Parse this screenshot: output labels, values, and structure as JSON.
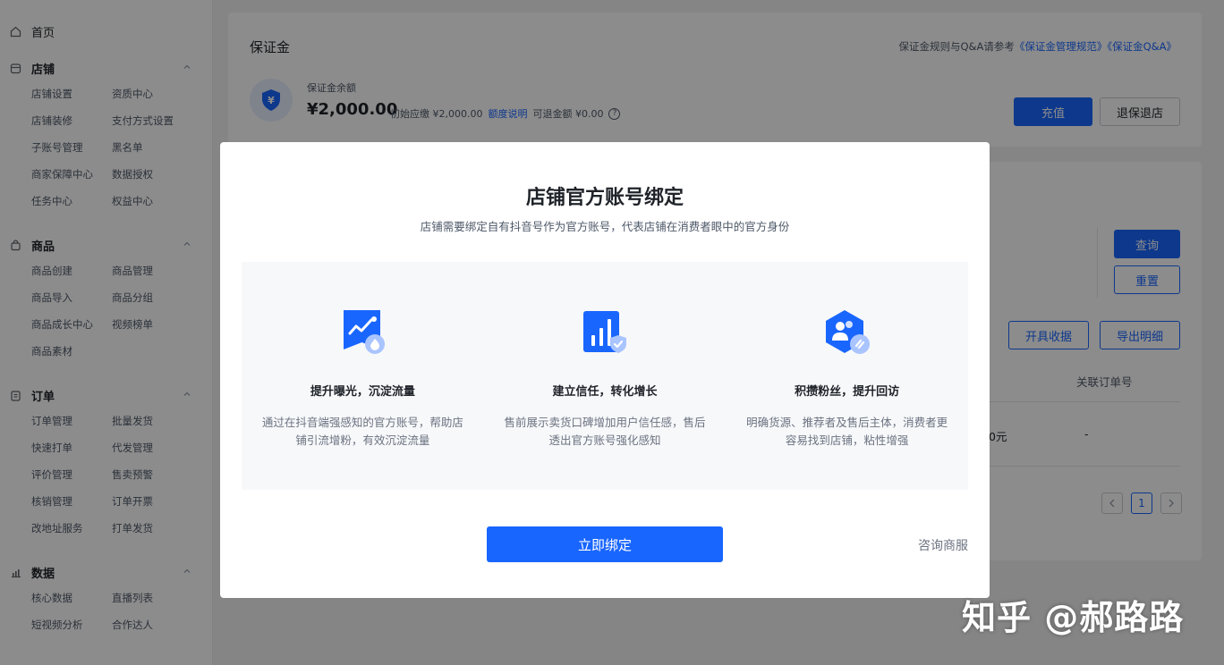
{
  "sidebar": {
    "home": "首页",
    "sections": [
      {
        "title": "店铺",
        "items": [
          "店铺设置",
          "资质中心",
          "店铺装修",
          "支付方式设置",
          "子账号管理",
          "黑名单",
          "商家保障中心",
          "数据授权",
          "任务中心",
          "权益中心"
        ]
      },
      {
        "title": "商品",
        "items": [
          "商品创建",
          "商品管理",
          "商品导入",
          "商品分组",
          "商品成长中心",
          "视频榜单",
          "商品素材"
        ]
      },
      {
        "title": "订单",
        "items": [
          "订单管理",
          "批量发货",
          "快速打单",
          "代发管理",
          "评价管理",
          "售卖预警",
          "核销管理",
          "订单开票",
          "改地址服务",
          "打单发货"
        ]
      },
      {
        "title": "数据",
        "items": [
          "核心数据",
          "直播列表",
          "短视频分析",
          "合作达人"
        ]
      }
    ]
  },
  "deposit": {
    "title": "保证金",
    "rule_prefix": "保证金规则与Q&A请参考",
    "rule_link1": "《保证金管理规范》",
    "rule_link2": "《保证金Q&A》",
    "balance_label": "保证金余额",
    "balance_amount": "¥2,000.00",
    "initial_due": "初始应缴 ¥2,000.00",
    "quota_link": "额度说明",
    "refundable": "可退金额 ¥0.00",
    "recharge_button": "充值",
    "refund_button": "退保退店"
  },
  "records": {
    "query_button": "查询",
    "reset_button": "重置",
    "invoice_button": "开具收据",
    "export_button": "导出明细",
    "col_related_order": "关联订单号",
    "cell_amount": "0元",
    "cell_order": "-",
    "page_current": "1"
  },
  "modal": {
    "title": "店铺官方账号绑定",
    "subtitle": "店铺需要绑定自有抖音号作为官方账号，代表店铺在消费者眼中的官方身份",
    "features": [
      {
        "icon": "chart-growth-icon",
        "title": "提升曝光，沉淀流量",
        "desc": "通过在抖音端强感知的官方账号，帮助店铺引流增粉，有效沉淀流量"
      },
      {
        "icon": "trust-bar-icon",
        "title": "建立信任，转化增长",
        "desc": "售前展示卖货口碑增加用户信任感，售后透出官方账号强化感知"
      },
      {
        "icon": "fans-hexagon-icon",
        "title": "积攒粉丝，提升回访",
        "desc": "明确货源、推荐者及售后主体，消费者更容易找到店铺，粘性增强"
      }
    ],
    "bind_button": "立即绑定",
    "consult_link": "咨询商服"
  },
  "watermark": "知乎 @郝路路",
  "colors": {
    "accent": "#1966ff"
  }
}
